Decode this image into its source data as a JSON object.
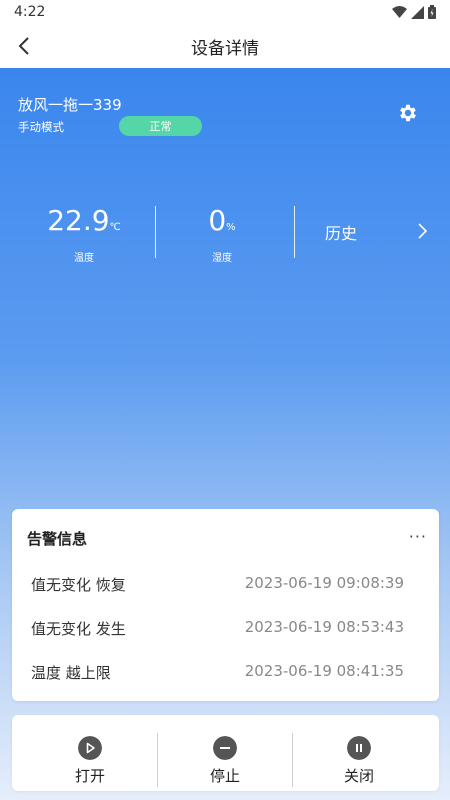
{
  "status_bar": {
    "time": "4:22"
  },
  "header": {
    "title": "设备详情"
  },
  "device": {
    "name": "放风一拖一339",
    "mode": "手动模式",
    "status": "正常"
  },
  "metrics": {
    "temperature": {
      "value": "22.9",
      "unit": "℃",
      "label": "温度"
    },
    "humidity": {
      "value": "0",
      "unit": "%",
      "label": "湿度"
    },
    "history_label": "历史"
  },
  "alerts": {
    "title": "告警信息",
    "more": "···",
    "items": [
      {
        "text": "值无变化 恢复",
        "time": "2023-06-19 09:08:39"
      },
      {
        "text": "值无变化 发生",
        "time": "2023-06-19 08:53:43"
      },
      {
        "text": "温度 越上限",
        "time": "2023-06-19 08:41:35"
      }
    ]
  },
  "controls": {
    "open_label": "打开",
    "stop_label": "停止",
    "close_label": "关闭"
  },
  "colors": {
    "accent": "#3a86ee",
    "status_ok": "#55d6a6",
    "icon": "#555555"
  }
}
